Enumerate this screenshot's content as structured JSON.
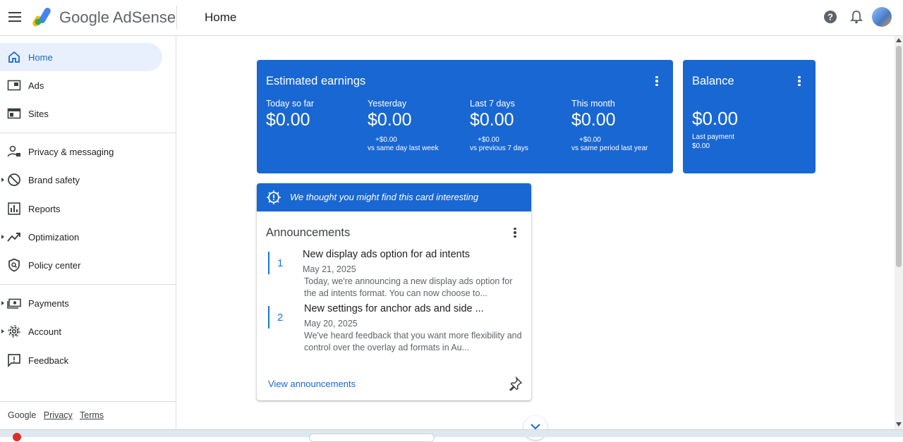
{
  "app": {
    "brand": "Google AdSense",
    "page_title": "Home"
  },
  "sidebar": {
    "items": [
      {
        "label": "Home",
        "active": true
      },
      {
        "label": "Ads"
      },
      {
        "label": "Sites"
      },
      {
        "label": "Privacy & messaging"
      },
      {
        "label": "Brand safety",
        "expandable": true
      },
      {
        "label": "Reports"
      },
      {
        "label": "Optimization",
        "expandable": true
      },
      {
        "label": "Policy center"
      },
      {
        "label": "Payments",
        "expandable": true
      },
      {
        "label": "Account",
        "expandable": true
      },
      {
        "label": "Feedback"
      }
    ],
    "footer": {
      "google": "Google",
      "privacy": "Privacy",
      "terms": "Terms"
    }
  },
  "earnings": {
    "title": "Estimated earnings",
    "metrics": [
      {
        "label": "Today so far",
        "value": "$0.00",
        "delta": "",
        "compare": ""
      },
      {
        "label": "Yesterday",
        "value": "$0.00",
        "delta": "+$0.00",
        "compare": "vs same day last week"
      },
      {
        "label": "Last 7 days",
        "value": "$0.00",
        "delta": "+$0.00",
        "compare": "vs previous 7 days"
      },
      {
        "label": "This month",
        "value": "$0.00",
        "delta": "+$0.00",
        "compare": "vs same period last year"
      }
    ]
  },
  "balance": {
    "title": "Balance",
    "value": "$0.00",
    "last_payment_label": "Last payment",
    "last_payment_value": "$0.00"
  },
  "announcements": {
    "hint": "We thought you might find this card interesting",
    "title": "Announcements",
    "items": [
      {
        "num": "1",
        "title": "New display ads option for ad intents",
        "date": "May 21, 2025",
        "desc": "Today, we're announcing a new display ads option for the ad intents format. You can now choose to..."
      },
      {
        "num": "2",
        "title": "New settings for anchor ads and side ...",
        "date": "May 20, 2025",
        "desc": "We've heard feedback that you want more flexibility and control over the overlay ad formats in Au..."
      }
    ],
    "view_link": "View announcements"
  },
  "colors": {
    "accent": "#1967d2",
    "active_nav": "#e8f0fe"
  },
  "icons": [
    "menu-icon",
    "help-icon",
    "bell-icon",
    "home-icon",
    "ads-icon",
    "sites-icon",
    "privacy-icon",
    "brand-safety-icon",
    "reports-icon",
    "optimization-icon",
    "policy-icon",
    "payments-icon",
    "account-icon",
    "feedback-icon",
    "kebab-icon",
    "lightbulb-icon",
    "pin-icon",
    "chevron-down-icon"
  ]
}
